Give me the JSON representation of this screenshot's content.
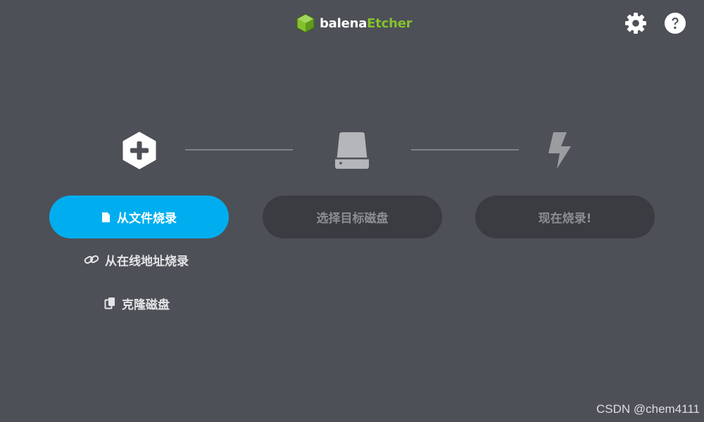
{
  "app": {
    "brand_name": "balena",
    "product_name": "Etcher"
  },
  "header": {
    "settings_icon": "gear-icon",
    "help_icon": "question-circle-icon"
  },
  "steps": [
    {
      "icon": "plus-hexagon-icon",
      "button_label": "从文件烧录",
      "button_icon": "file-icon",
      "state": "active"
    },
    {
      "icon": "drive-icon",
      "button_label": "选择目标磁盘",
      "state": "disabled"
    },
    {
      "icon": "lightning-icon",
      "button_label": "现在烧录!",
      "state": "disabled"
    }
  ],
  "secondary_actions": {
    "flash_from_url": {
      "label": "从在线地址烧录",
      "icon": "link-icon"
    },
    "clone_drive": {
      "label": "克隆磁盘",
      "icon": "copy-icon"
    }
  },
  "watermark": "CSDN @chem4111",
  "colors": {
    "background": "#4d5057",
    "accent": "#00aeef",
    "brand_green": "#85c12d",
    "disabled_button": "#3a3c41",
    "disabled_text": "#8b8d92"
  }
}
